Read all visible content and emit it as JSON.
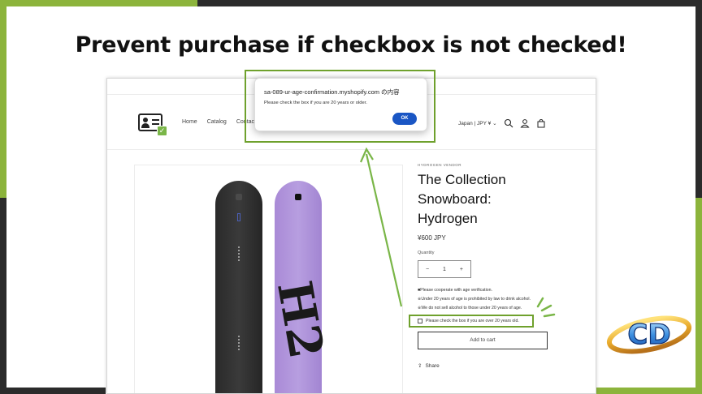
{
  "headline": "Prevent purchase if checkbox is not checked!",
  "colors": {
    "accent_green": "#8cb43c",
    "frame_dark": "#2b2b2b",
    "ok_button": "#1a56c4"
  },
  "store": {
    "nav": [
      "Home",
      "Catalog",
      "Contact"
    ],
    "locale": "Japan | JPY ¥",
    "icons": [
      "search-icon",
      "account-icon",
      "cart-icon"
    ]
  },
  "product": {
    "vendor": "HYDROGEN VENDOR",
    "title": "The Collection Snowboard: Hydrogen",
    "price": "¥600 JPY",
    "quantity_label": "Quantity",
    "quantity_value": "1",
    "decrement": "−",
    "increment": "+",
    "note1": "■Please cooperate with age verification.",
    "note2": "※Under 20 years of age is prohibited by law to drink alcohol.",
    "note3": "※We do not sell alcohol to those under 20 years of age.",
    "checkbox_label": "Please check the box if you are over 20 years old.",
    "add_to_cart": "Add to cart",
    "share": "Share"
  },
  "dialog": {
    "title": "sa-089-ur-age-confirmation.myshopify.com の内容",
    "message": "Please check the box if you are 20 years or older.",
    "ok": "OK"
  },
  "brand_logo_text": "CD"
}
